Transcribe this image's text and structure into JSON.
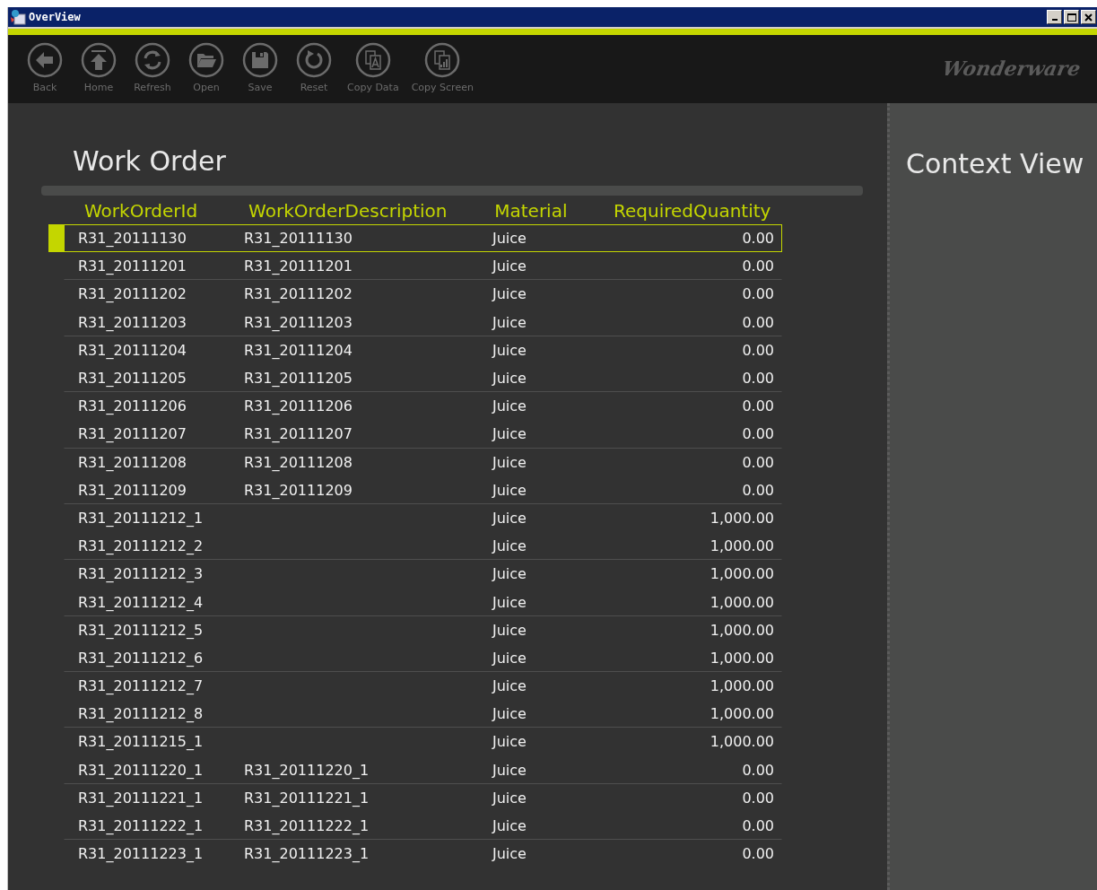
{
  "window": {
    "title": "OverView"
  },
  "toolbar": [
    {
      "label": "Back",
      "kind": "back"
    },
    {
      "label": "Home",
      "kind": "home"
    },
    {
      "label": "Refresh",
      "kind": "refresh"
    },
    {
      "label": "Open",
      "kind": "open"
    },
    {
      "label": "Save",
      "kind": "save"
    },
    {
      "label": "Reset",
      "kind": "reset"
    },
    {
      "label": "Copy Data",
      "kind": "copy-data"
    },
    {
      "label": "Copy Screen",
      "kind": "copy-screen"
    }
  ],
  "logo": "Wonderware",
  "work_order": {
    "title": "Work Order",
    "columns": [
      "WorkOrderId",
      "WorkOrderDescription",
      "Material",
      "RequiredQuantity"
    ],
    "rows": [
      {
        "id": "R31_20111130",
        "description": "R31_20111130",
        "material": "Juice",
        "quantity": "0.00",
        "selected": true
      },
      {
        "id": "R31_20111201",
        "description": "R31_20111201",
        "material": "Juice",
        "quantity": "0.00",
        "selected": false
      },
      {
        "id": "R31_20111202",
        "description": "R31_20111202",
        "material": "Juice",
        "quantity": "0.00",
        "selected": false
      },
      {
        "id": "R31_20111203",
        "description": "R31_20111203",
        "material": "Juice",
        "quantity": "0.00",
        "selected": false
      },
      {
        "id": "R31_20111204",
        "description": "R31_20111204",
        "material": "Juice",
        "quantity": "0.00",
        "selected": false
      },
      {
        "id": "R31_20111205",
        "description": "R31_20111205",
        "material": "Juice",
        "quantity": "0.00",
        "selected": false
      },
      {
        "id": "R31_20111206",
        "description": "R31_20111206",
        "material": "Juice",
        "quantity": "0.00",
        "selected": false
      },
      {
        "id": "R31_20111207",
        "description": "R31_20111207",
        "material": "Juice",
        "quantity": "0.00",
        "selected": false
      },
      {
        "id": "R31_20111208",
        "description": "R31_20111208",
        "material": "Juice",
        "quantity": "0.00",
        "selected": false
      },
      {
        "id": "R31_20111209",
        "description": "R31_20111209",
        "material": "Juice",
        "quantity": "0.00",
        "selected": false
      },
      {
        "id": "R31_20111212_1",
        "material": "Juice",
        "quantity": "1,000.00",
        "selected": false
      },
      {
        "id": "R31_20111212_2",
        "material": "Juice",
        "quantity": "1,000.00",
        "selected": false
      },
      {
        "id": "R31_20111212_3",
        "material": "Juice",
        "quantity": "1,000.00",
        "selected": false
      },
      {
        "id": "R31_20111212_4",
        "material": "Juice",
        "quantity": "1,000.00",
        "selected": false
      },
      {
        "id": "R31_20111212_5",
        "material": "Juice",
        "quantity": "1,000.00",
        "selected": false
      },
      {
        "id": "R31_20111212_6",
        "material": "Juice",
        "quantity": "1,000.00",
        "selected": false
      },
      {
        "id": "R31_20111212_7",
        "material": "Juice",
        "quantity": "1,000.00",
        "selected": false
      },
      {
        "id": "R31_20111212_8",
        "material": "Juice",
        "quantity": "1,000.00",
        "selected": false
      },
      {
        "id": "R31_20111215_1",
        "material": "Juice",
        "quantity": "1,000.00",
        "selected": false
      },
      {
        "id": "R31_20111220_1",
        "description": "R31_20111220_1",
        "material": "Juice",
        "quantity": "0.00",
        "selected": false
      },
      {
        "id": "R31_20111221_1",
        "description": "R31_20111221_1",
        "material": "Juice",
        "quantity": "0.00",
        "selected": false
      },
      {
        "id": "R31_20111222_1",
        "description": "R31_20111222_1",
        "material": "Juice",
        "quantity": "0.00",
        "selected": false
      },
      {
        "id": "R31_20111223_1",
        "description": "R31_20111223_1",
        "material": "Juice",
        "quantity": "0.00",
        "selected": false
      }
    ]
  },
  "context_view": {
    "title": "Context View"
  }
}
